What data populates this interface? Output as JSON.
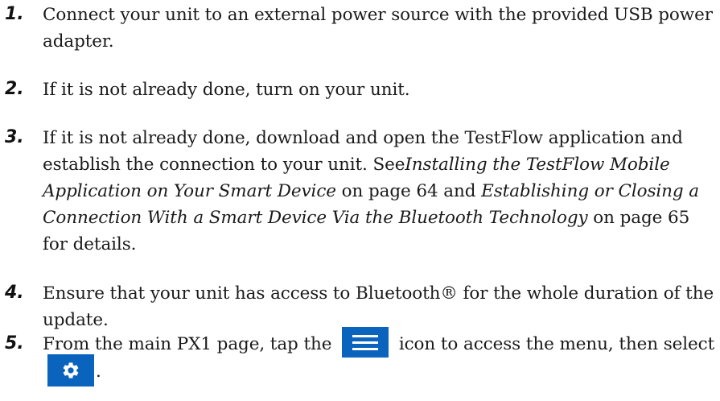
{
  "steps": [
    {
      "number": "1.",
      "text": "Connect your unit to an external power source with the provided USB power adapter."
    },
    {
      "number": "2.",
      "text": "If it is not already done, turn on your unit."
    },
    {
      "number": "3.",
      "text_before_link1": "If it is not already done, download and open the TestFlow application and establish the connection to your unit. See",
      "link1": "Installing the TestFlow Mobile Application on Your Smart Device",
      "text_between": " on page 64 and ",
      "link2": "Establishing or Closing a Connection With a Smart Device Via the Bluetooth Technology",
      "text_after": " on page 65 for details."
    },
    {
      "number": "4.",
      "text": "Ensure that your unit has access to Bluetooth® for the whole duration of the update."
    },
    {
      "number": "5.",
      "text_before_icon": "From the main PX1 page, tap the ",
      "icon_menu": "menu-icon",
      "text_after_icon": " icon to access the menu, then select ",
      "icon_settings": "gear-icon",
      "text_end": "."
    }
  ],
  "icon_color": "#0a63bd"
}
